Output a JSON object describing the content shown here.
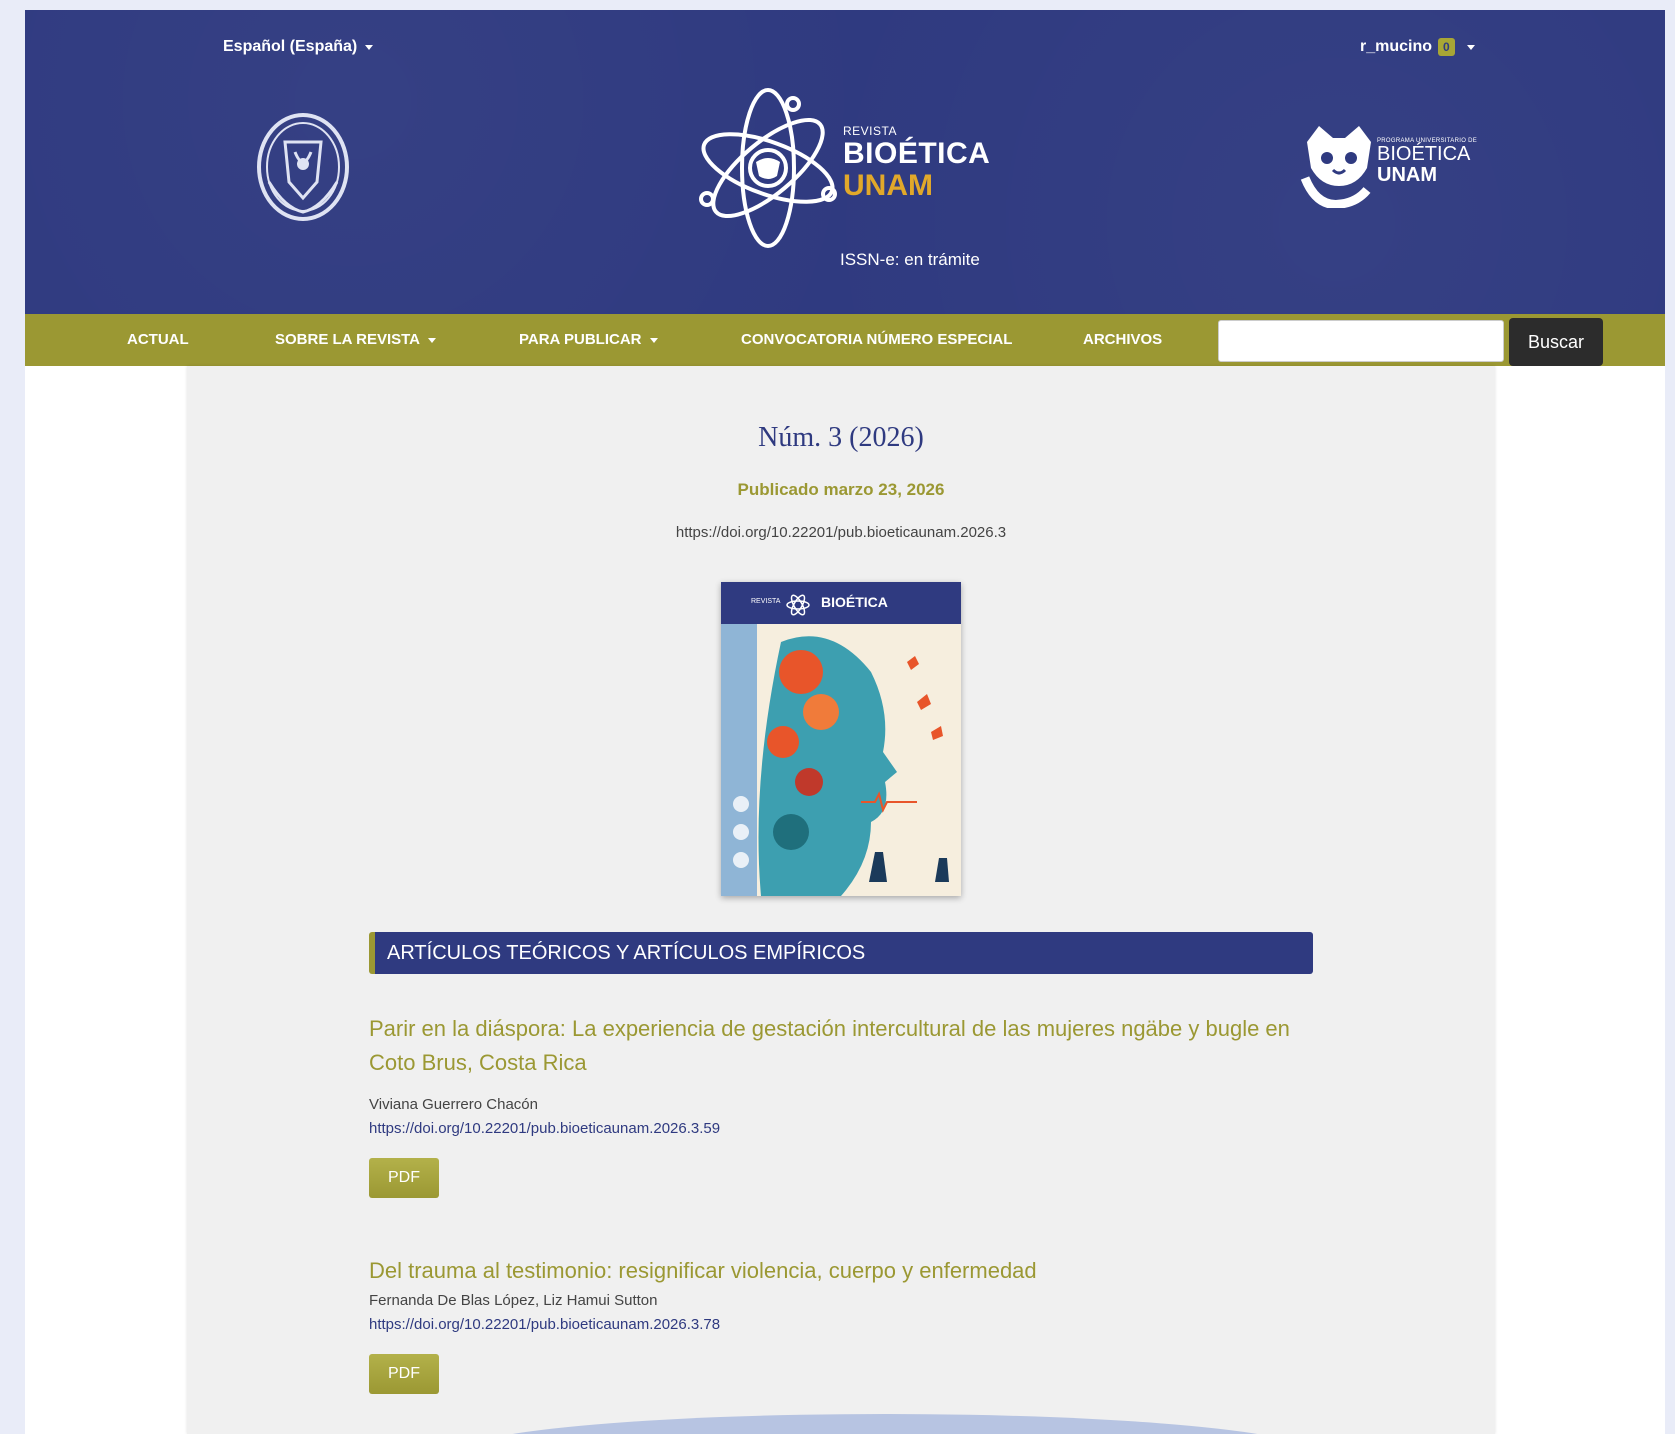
{
  "header": {
    "language": "Español (España)",
    "user": "r_mucino",
    "user_badge": "0",
    "brand_small": "REVISTA",
    "brand_big": "BIOÉTICA",
    "brand_gold": "UNAM",
    "issn": "ISSN-e: en trámite",
    "program_small": "PROGRAMA UNIVERSITARIO DE",
    "program_big": "BIOÉTICA",
    "program_unam": "UNAM"
  },
  "nav": {
    "items": [
      "ACTUAL",
      "SOBRE LA REVISTA",
      "PARA PUBLICAR",
      "CONVOCATORIA NÚMERO ESPECIAL",
      "ARCHIVOS"
    ],
    "search_button": "Buscar"
  },
  "issue": {
    "title": "Núm. 3 (2026)",
    "published": "Publicado marzo 23, 2026",
    "doi": "https://doi.org/10.22201/pub.bioeticaunam.2026.3",
    "cover_brand": "BIOÉTICA",
    "cover_small": "REVISTA"
  },
  "section": {
    "title": "ARTÍCULOS TEÓRICOS Y ARTÍCULOS EMPÍRICOS"
  },
  "articles": [
    {
      "title": "Parir en la diáspora: La experiencia de gestación intercultural de las mujeres ngäbe y bugle en Coto Brus, Costa Rica",
      "authors": "Viviana Guerrero Chacón",
      "doi": "https://doi.org/10.22201/pub.bioeticaunam.2026.3.59",
      "pdf": "PDF"
    },
    {
      "title": "Del trauma al testimonio: resignificar violencia, cuerpo y enfermedad",
      "authors": "Fernanda De Blas López, Liz Hamui Sutton",
      "doi": "https://doi.org/10.22201/pub.bioeticaunam.2026.3.78",
      "pdf": "PDF"
    }
  ],
  "colors": {
    "header_blue": "#2f3a80",
    "olive": "#9b9833",
    "gold": "#e1a82a"
  }
}
